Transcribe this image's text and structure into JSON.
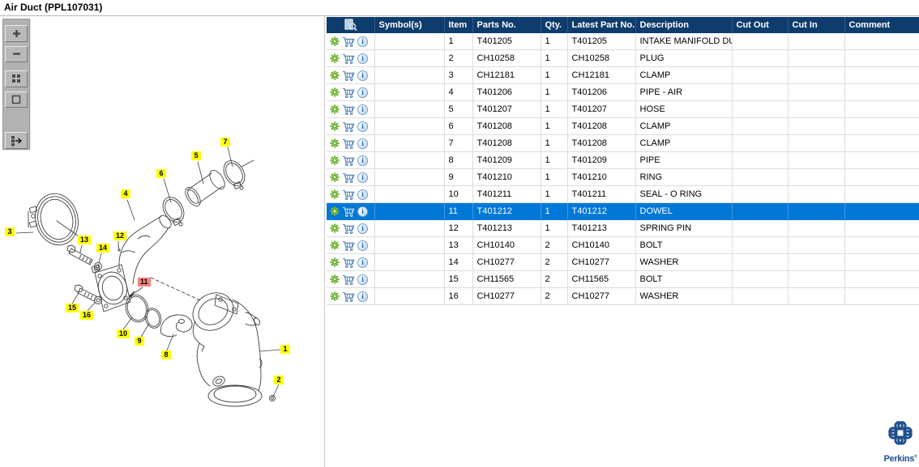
{
  "header": {
    "title": "Air Duct (PPL107031)"
  },
  "toolbar": {
    "buttons": [
      "zoom-in-icon",
      "zoom-out-icon",
      "tile-view-icon",
      "single-view-icon",
      "toggle-parts-list-icon"
    ]
  },
  "diagram": {
    "callouts": [
      {
        "label": "1",
        "selected": false
      },
      {
        "label": "2",
        "selected": false
      },
      {
        "label": "3",
        "selected": false
      },
      {
        "label": "4",
        "selected": false
      },
      {
        "label": "5",
        "selected": false
      },
      {
        "label": "6",
        "selected": false
      },
      {
        "label": "7",
        "selected": false
      },
      {
        "label": "8",
        "selected": false
      },
      {
        "label": "9",
        "selected": false
      },
      {
        "label": "10",
        "selected": false
      },
      {
        "label": "11",
        "selected": true
      },
      {
        "label": "12",
        "selected": false
      },
      {
        "label": "13",
        "selected": false
      },
      {
        "label": "14",
        "selected": false
      },
      {
        "label": "15",
        "selected": false
      },
      {
        "label": "16",
        "selected": false
      }
    ]
  },
  "table": {
    "columns": [
      {
        "label": "",
        "icon": "preview-search-icon"
      },
      {
        "label": "Symbol(s)"
      },
      {
        "label": "Item"
      },
      {
        "label": "Parts No."
      },
      {
        "label": "Qty."
      },
      {
        "label": "Latest Part No."
      },
      {
        "label": "Description"
      },
      {
        "label": "Cut Out"
      },
      {
        "label": "Cut In"
      },
      {
        "label": "Comment"
      }
    ],
    "row_icons": [
      "gear-icon",
      "cart-icon",
      "info-icon"
    ],
    "rows": [
      {
        "item": "1",
        "parts_no": "T401205",
        "qty": "1",
        "latest_part_no": "T401205",
        "description": "INTAKE MANIFOLD DU",
        "symbols": "",
        "cut_out": "",
        "cut_in": "",
        "comment": "",
        "selected": false
      },
      {
        "item": "2",
        "parts_no": "CH10258",
        "qty": "1",
        "latest_part_no": "CH10258",
        "description": "PLUG",
        "symbols": "",
        "cut_out": "",
        "cut_in": "",
        "comment": "",
        "selected": false
      },
      {
        "item": "3",
        "parts_no": "CH12181",
        "qty": "1",
        "latest_part_no": "CH12181",
        "description": "CLAMP",
        "symbols": "",
        "cut_out": "",
        "cut_in": "",
        "comment": "",
        "selected": false
      },
      {
        "item": "4",
        "parts_no": "T401206",
        "qty": "1",
        "latest_part_no": "T401206",
        "description": "PIPE - AIR",
        "symbols": "",
        "cut_out": "",
        "cut_in": "",
        "comment": "",
        "selected": false
      },
      {
        "item": "5",
        "parts_no": "T401207",
        "qty": "1",
        "latest_part_no": "T401207",
        "description": "HOSE",
        "symbols": "",
        "cut_out": "",
        "cut_in": "",
        "comment": "",
        "selected": false
      },
      {
        "item": "6",
        "parts_no": "T401208",
        "qty": "1",
        "latest_part_no": "T401208",
        "description": "CLAMP",
        "symbols": "",
        "cut_out": "",
        "cut_in": "",
        "comment": "",
        "selected": false
      },
      {
        "item": "7",
        "parts_no": "T401208",
        "qty": "1",
        "latest_part_no": "T401208",
        "description": "CLAMP",
        "symbols": "",
        "cut_out": "",
        "cut_in": "",
        "comment": "",
        "selected": false
      },
      {
        "item": "8",
        "parts_no": "T401209",
        "qty": "1",
        "latest_part_no": "T401209",
        "description": "PIPE",
        "symbols": "",
        "cut_out": "",
        "cut_in": "",
        "comment": "",
        "selected": false
      },
      {
        "item": "9",
        "parts_no": "T401210",
        "qty": "1",
        "latest_part_no": "T401210",
        "description": "RING",
        "symbols": "",
        "cut_out": "",
        "cut_in": "",
        "comment": "",
        "selected": false
      },
      {
        "item": "10",
        "parts_no": "T401211",
        "qty": "1",
        "latest_part_no": "T401211",
        "description": "SEAL - O RING",
        "symbols": "",
        "cut_out": "",
        "cut_in": "",
        "comment": "",
        "selected": false
      },
      {
        "item": "11",
        "parts_no": "T401212",
        "qty": "1",
        "latest_part_no": "T401212",
        "description": "DOWEL",
        "symbols": "",
        "cut_out": "",
        "cut_in": "",
        "comment": "",
        "selected": true
      },
      {
        "item": "12",
        "parts_no": "T401213",
        "qty": "1",
        "latest_part_no": "T401213",
        "description": "SPRING PIN",
        "symbols": "",
        "cut_out": "",
        "cut_in": "",
        "comment": "",
        "selected": false
      },
      {
        "item": "13",
        "parts_no": "CH10140",
        "qty": "2",
        "latest_part_no": "CH10140",
        "description": "BOLT",
        "symbols": "",
        "cut_out": "",
        "cut_in": "",
        "comment": "",
        "selected": false
      },
      {
        "item": "14",
        "parts_no": "CH10277",
        "qty": "2",
        "latest_part_no": "CH10277",
        "description": "WASHER",
        "symbols": "",
        "cut_out": "",
        "cut_in": "",
        "comment": "",
        "selected": false
      },
      {
        "item": "15",
        "parts_no": "CH11565",
        "qty": "2",
        "latest_part_no": "CH11565",
        "description": "BOLT",
        "symbols": "",
        "cut_out": "",
        "cut_in": "",
        "comment": "",
        "selected": false
      },
      {
        "item": "16",
        "parts_no": "CH10277",
        "qty": "2",
        "latest_part_no": "CH10277",
        "description": "WASHER",
        "symbols": "",
        "cut_out": "",
        "cut_in": "",
        "comment": "",
        "selected": false
      }
    ]
  },
  "branding": {
    "logo_text": "Perkins",
    "registered_mark": "®",
    "logo_icon": "perkins-quatrefoil-icon"
  },
  "colors": {
    "header_bg": "#0e3c6c",
    "selected_row": "#0078d7",
    "callout_bg": "#ffff00",
    "callout_selected_bg": "#f4827d",
    "gear_green": "#76b43e",
    "cart_blue": "#4a7ebb",
    "logo_blue": "#1d4f8d"
  }
}
